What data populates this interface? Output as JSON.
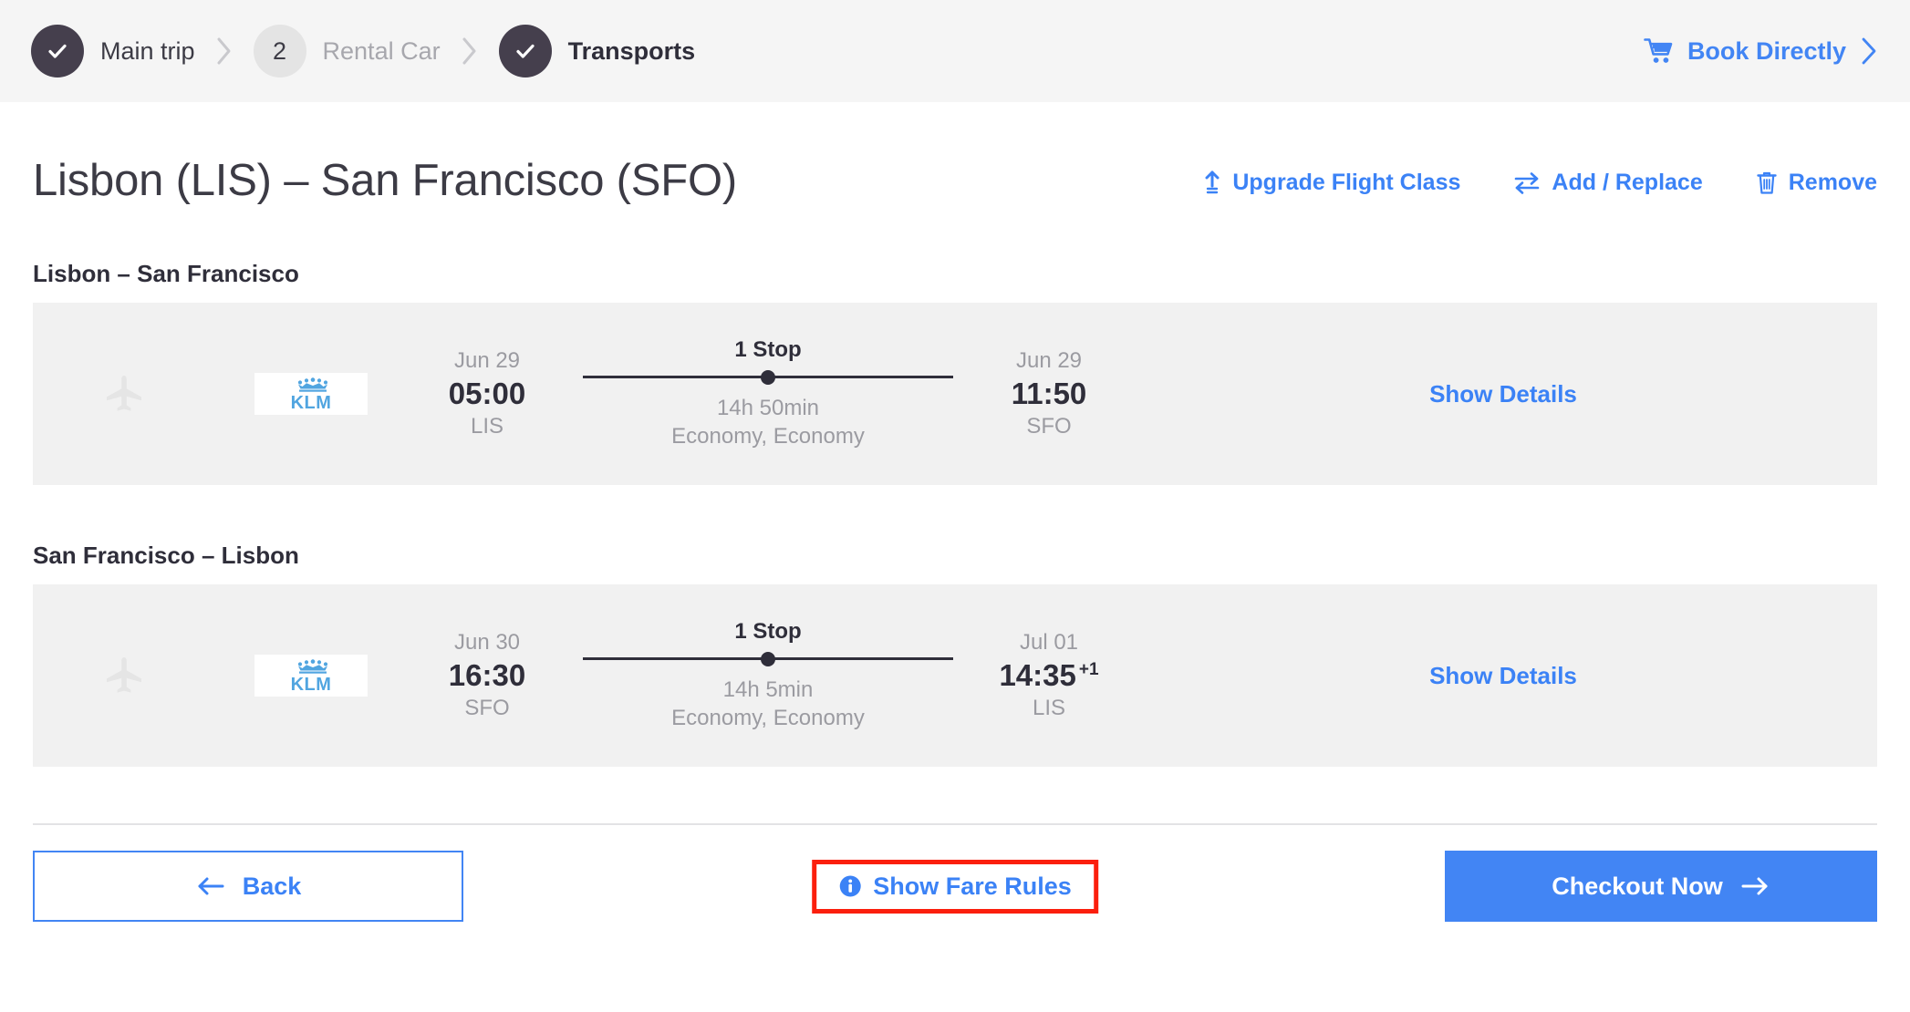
{
  "header": {
    "steps": [
      {
        "label": "Main trip",
        "state": "done",
        "icon": "check-icon",
        "number": ""
      },
      {
        "label": "Rental Car",
        "state": "pending",
        "icon": "",
        "number": "2"
      },
      {
        "label": "Transports",
        "state": "active",
        "icon": "check-icon",
        "number": ""
      }
    ],
    "book_directly": {
      "label": "Book Directly",
      "cart_icon": "shopping-cart-icon",
      "chevron_icon": "chevron-right-icon"
    }
  },
  "page": {
    "title": "Lisbon (LIS) – San Francisco (SFO)",
    "actions": [
      {
        "label": "Upgrade Flight Class",
        "icon": "upgrade-arrow-icon"
      },
      {
        "label": "Add / Replace",
        "icon": "swap-arrows-icon"
      },
      {
        "label": "Remove",
        "icon": "trash-icon"
      }
    ]
  },
  "legs": [
    {
      "heading": "Lisbon – San Francisco",
      "plane_icon": "airplane-icon",
      "airline": "KLM",
      "airline_logo": "klm-logo",
      "depart": {
        "date": "Jun 29",
        "time": "05:00",
        "code": "LIS",
        "day_offset": ""
      },
      "route": {
        "stops": "1 Stop",
        "duration": "14h 50min",
        "cabin": "Economy, Economy"
      },
      "arrive": {
        "date": "Jun 29",
        "time": "11:50",
        "code": "SFO",
        "day_offset": ""
      },
      "details_label": "Show Details"
    },
    {
      "heading": "San Francisco – Lisbon",
      "plane_icon": "airplane-icon",
      "airline": "KLM",
      "airline_logo": "klm-logo",
      "depart": {
        "date": "Jun 30",
        "time": "16:30",
        "code": "SFO",
        "day_offset": ""
      },
      "route": {
        "stops": "1 Stop",
        "duration": "14h 5min",
        "cabin": "Economy, Economy"
      },
      "arrive": {
        "date": "Jul 01",
        "time": "14:35",
        "code": "LIS",
        "day_offset": "+1"
      },
      "details_label": "Show Details"
    }
  ],
  "footer": {
    "back": {
      "label": "Back",
      "icon": "arrow-left-icon"
    },
    "fare_rules": {
      "label": "Show Fare Rules",
      "icon": "info-icon",
      "highlighted": true
    },
    "checkout": {
      "label": "Checkout Now",
      "icon": "arrow-right-icon"
    }
  },
  "colors": {
    "accent_blue": "#4285f4",
    "link_blue": "#3b82f6",
    "dark": "#2f2e3a",
    "step_done": "#453f4d",
    "muted": "#9b9ba1",
    "card_bg": "#f1f1f1",
    "header_bg": "#f5f5f5",
    "highlight_red": "#fb1f0d",
    "klm_blue": "#51a5e0"
  }
}
